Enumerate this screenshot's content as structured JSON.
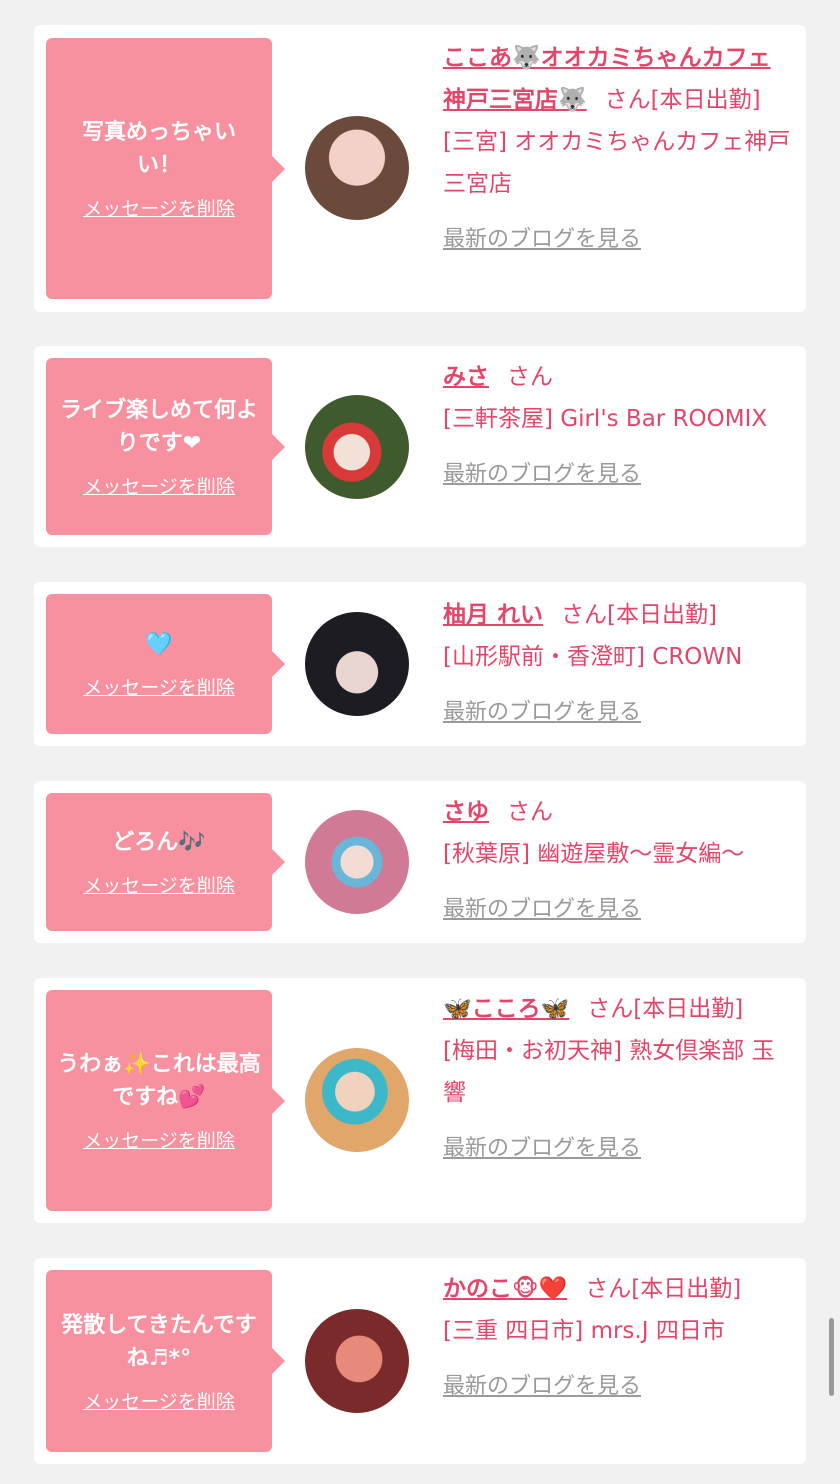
{
  "cards": [
    {
      "message": "写真めっちゃいい！",
      "delete_label": "メッセージを削除",
      "name": "ここあ🐺オオカミちゃんカフェ神戸三宮店🐺",
      "suffix": "さん[本日出勤]",
      "store": "[三宮] オオカミちゃんカフェ神戸三宮店",
      "blog_label": "最新のブログを見る",
      "avatar_colors": [
        "#f2d2c8",
        "#6b4a3c"
      ]
    },
    {
      "message": "ライブ楽しめて何よりです❤",
      "delete_label": "メッセージを削除",
      "name": "みさ",
      "suffix": "さん",
      "store": "[三軒茶屋] Girl's Bar ROOMIX",
      "blog_label": "最新のブログを見る",
      "avatar_colors": [
        "#3f5a2c",
        "#d83a3a"
      ]
    },
    {
      "message": "🩵",
      "delete_label": "メッセージを削除",
      "name": "柚月 れい",
      "suffix": "さん[本日出勤]",
      "store": "[山形駅前・香澄町] CROWN",
      "blog_label": "最新のブログを見る",
      "avatar_colors": [
        "#1c1c22",
        "#e9d6d0"
      ]
    },
    {
      "message": "どろん🎶",
      "delete_label": "メッセージを削除",
      "name": "さゆ",
      "suffix": "さん",
      "store": "[秋葉原] 幽遊屋敷〜霊女編〜",
      "blog_label": "最新のブログを見る",
      "avatar_colors": [
        "#d07a96",
        "#6ab6d8"
      ]
    },
    {
      "message": "うわぁ✨これは最高ですね💕",
      "delete_label": "メッセージを削除",
      "name": "🦋こころ🦋",
      "suffix": "さん[本日出勤]",
      "store": "[梅田・お初天神] 熟女倶楽部 玉響",
      "blog_label": "最新のブログを見る",
      "avatar_colors": [
        "#e0a66a",
        "#3cb8c8"
      ]
    },
    {
      "message": "発散してきたんですね♬*°",
      "delete_label": "メッセージを削除",
      "name": "かのこ🐵❤️",
      "suffix": "さん[本日出勤]",
      "store": "[三重 四日市] mrs.J 四日市",
      "blog_label": "最新のブログを見る",
      "avatar_colors": [
        "#7a2a2a",
        "#e88a7a"
      ]
    }
  ]
}
